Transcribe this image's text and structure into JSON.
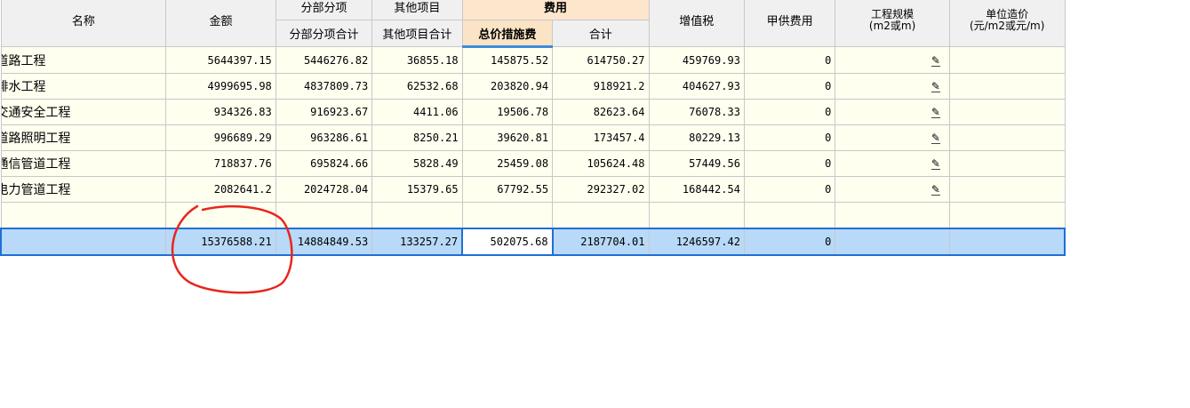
{
  "headers": {
    "name": "名称",
    "amount": "金额",
    "group_sub": "分部分项",
    "group_other": "其他项目",
    "group_fee": "费用",
    "sub_total": "分部分项合计",
    "other_total": "其他项目合计",
    "measure_total": "总价措施费",
    "fee_sum": "合计",
    "vat": "增值税",
    "owner_supply": "甲供费用",
    "scale_line1": "工程规模",
    "scale_line2": "(m2或m)",
    "unit_cost_line1": "单位造价",
    "unit_cost_line2": "(元/m2或元/m)"
  },
  "rows": [
    {
      "name": "道路工程",
      "amount": "5644397.15",
      "sub": "5446276.82",
      "other": "36855.18",
      "measure": "145875.52",
      "fee_sum": "614750.27",
      "vat": "459769.93",
      "owner": "0"
    },
    {
      "name": "排水工程",
      "amount": "4999695.98",
      "sub": "4837809.73",
      "other": "62532.68",
      "measure": "203820.94",
      "fee_sum": "918921.2",
      "vat": "404627.93",
      "owner": "0"
    },
    {
      "name": "交通安全工程",
      "amount": "934326.83",
      "sub": "916923.67",
      "other": "4411.06",
      "measure": "19506.78",
      "fee_sum": "82623.64",
      "vat": "76078.33",
      "owner": "0"
    },
    {
      "name": "道路照明工程",
      "amount": "996689.29",
      "sub": "963286.61",
      "other": "8250.21",
      "measure": "39620.81",
      "fee_sum": "173457.4",
      "vat": "80229.13",
      "owner": "0"
    },
    {
      "name": "通信管道工程",
      "amount": "718837.76",
      "sub": "695824.66",
      "other": "5828.49",
      "measure": "25459.08",
      "fee_sum": "105624.48",
      "vat": "57449.56",
      "owner": "0"
    },
    {
      "name": "电力管道工程",
      "amount": "2082641.2",
      "sub": "2024728.04",
      "other": "15379.65",
      "measure": "67792.55",
      "fee_sum": "292327.02",
      "vat": "168442.54",
      "owner": "0"
    }
  ],
  "total": {
    "amount": "15376588.21",
    "sub": "14884849.53",
    "other": "133257.27",
    "measure": "502075.68",
    "fee_sum": "2187704.01",
    "vat": "1246597.42",
    "owner": "0"
  },
  "edit_icon": "pencil-icon",
  "colors": {
    "accent": "#1f6fd6",
    "row_bg": "#fffff0",
    "total_bg": "#b8d9f7",
    "annotation": "#e8261c"
  }
}
